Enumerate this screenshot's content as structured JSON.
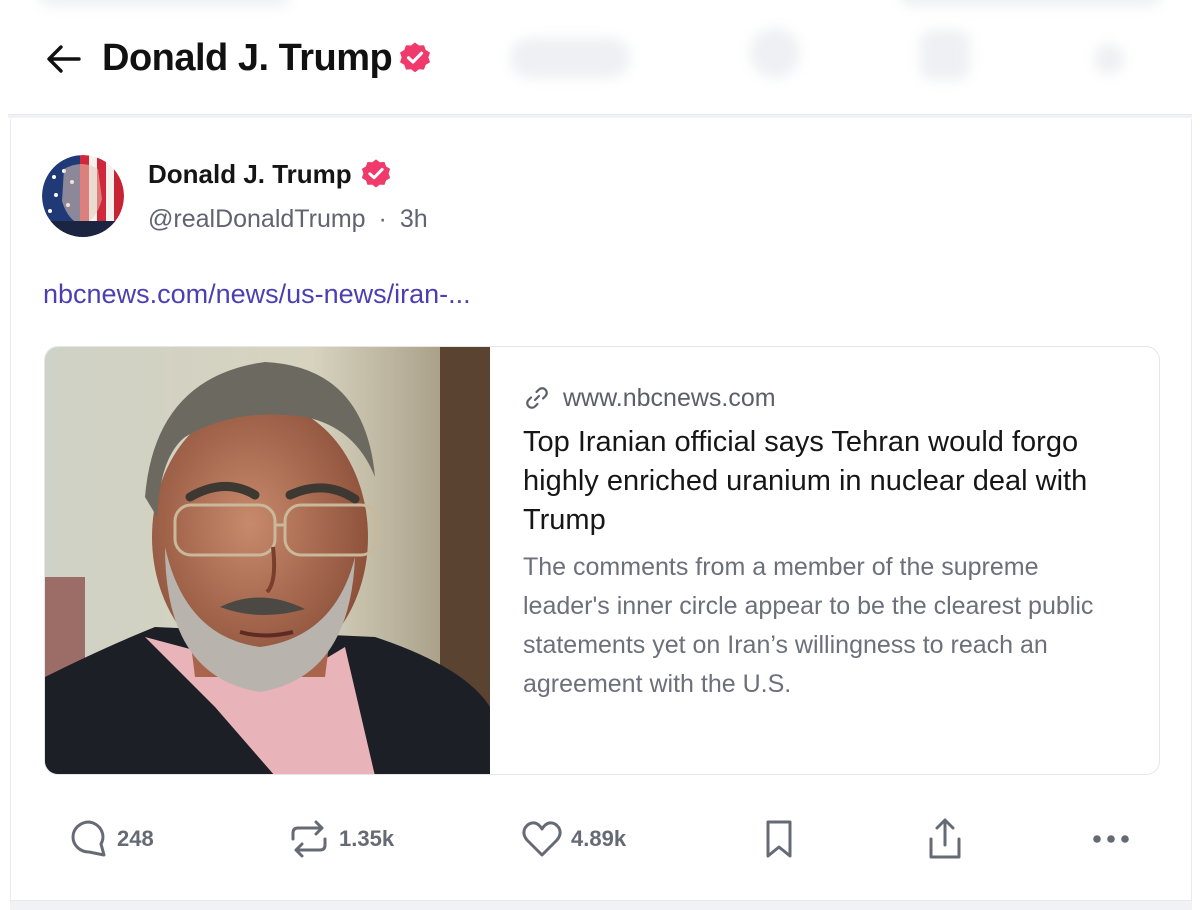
{
  "header": {
    "title": "Donald J. Trump",
    "back_icon": "arrow-left-icon",
    "verified_icon": "verified-badge-icon"
  },
  "post": {
    "author": {
      "name": "Donald J. Trump",
      "handle": "@realDonaldTrump",
      "separator": "·",
      "time": "3h"
    },
    "link_text": "nbcnews.com/news/us-news/iran-...",
    "card": {
      "domain": "www.nbcnews.com",
      "link_icon": "link-icon",
      "title": "Top Iranian official says Tehran would forgo highly enriched uranium in nuclear deal with Trump",
      "description": "The comments from a member of the supreme leader's inner circle appear to be the clearest public statements yet on Iran’s willingness to reach an agreement with the U.S.",
      "image_alt": "photo of gray-haired man with glasses"
    },
    "actions": {
      "replies": "248",
      "reblogs": "1.35k",
      "likes": "4.89k"
    }
  },
  "colors": {
    "verified": "#ef3a6b",
    "link": "#4b3fb2",
    "muted_text": "#656a75"
  }
}
